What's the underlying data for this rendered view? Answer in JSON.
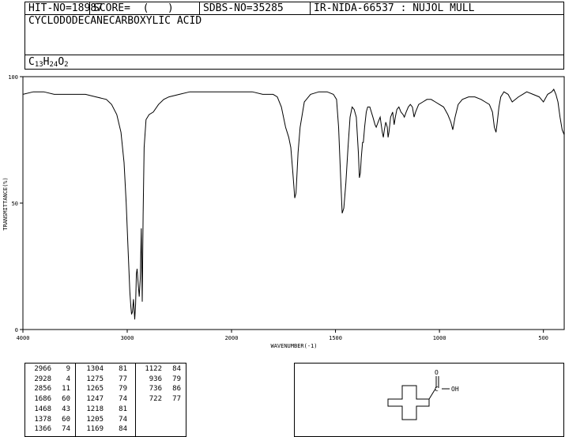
{
  "header": {
    "hit_no": "HIT-NO=18987",
    "score": "SCORE=  (   )",
    "sdbs_no": "SDBS-NO=35285",
    "ir_nida": "IR-NIDA-66537 : NUJOL MULL"
  },
  "compound": {
    "name": "CYCLODODECANECARBOXYLIC ACID",
    "formula": {
      "c": "C",
      "c_n": "13",
      "h": "H",
      "h_n": "24",
      "o": "O",
      "o_n": "2"
    }
  },
  "chart_data": {
    "type": "line",
    "xlabel": "WAVENUMBER(-1)",
    "ylabel": "TRANSMITTANCE(%)",
    "xlim": [
      4000,
      400
    ],
    "ylim": [
      0,
      100
    ],
    "x_ticks": [
      "4000",
      "3000",
      "2000",
      "1500",
      "1000",
      "500"
    ],
    "y_ticks": [
      "100",
      "50",
      "0"
    ],
    "series": [
      {
        "x": [
          4000,
          3900,
          3800,
          3700,
          3600,
          3500,
          3400,
          3300,
          3200,
          3150,
          3100,
          3060,
          3030,
          3010,
          2990,
          2975,
          2965,
          2958,
          2950,
          2940,
          2928,
          2920,
          2912,
          2905,
          2895,
          2885,
          2875,
          2865,
          2856,
          2848,
          2838,
          2820,
          2790,
          2750,
          2700,
          2650,
          2600,
          2500,
          2400,
          2300,
          2200,
          2100,
          2000,
          1900,
          1850,
          1800,
          1780,
          1760,
          1740,
          1725,
          1715,
          1705,
          1696,
          1690,
          1686,
          1680,
          1670,
          1650,
          1620,
          1580,
          1540,
          1510,
          1495,
          1485,
          1475,
          1468,
          1460,
          1450,
          1440,
          1430,
          1420,
          1410,
          1400,
          1390,
          1385,
          1380,
          1376,
          1370,
          1366,
          1360,
          1352,
          1345,
          1335,
          1320,
          1310,
          1304,
          1295,
          1285,
          1275,
          1270,
          1265,
          1258,
          1251,
          1247,
          1243,
          1235,
          1225,
          1218,
          1212,
          1205,
          1195,
          1185,
          1175,
          1169,
          1160,
          1150,
          1140,
          1130,
          1122,
          1115,
          1100,
          1080,
          1060,
          1040,
          1020,
          1000,
          980,
          960,
          945,
          936,
          925,
          910,
          890,
          860,
          830,
          800,
          780,
          760,
          745,
          736,
          728,
          722,
          714,
          705,
          690,
          670,
          650,
          620,
          600,
          580,
          550,
          520,
          500,
          480,
          460,
          450,
          440,
          430,
          420,
          410,
          400
        ],
        "y": [
          93,
          94,
          94,
          93,
          93,
          93,
          93,
          92,
          91,
          89,
          85,
          78,
          66,
          50,
          30,
          15,
          9,
          6,
          7,
          12,
          4,
          10,
          22,
          24,
          18,
          13,
          20,
          40,
          11,
          45,
          72,
          83,
          85,
          86,
          89,
          91,
          92,
          93,
          94,
          94,
          94,
          94,
          94,
          94,
          93,
          93,
          92,
          88,
          80,
          76,
          72,
          62,
          52,
          54,
          60,
          70,
          80,
          90,
          93,
          94,
          94,
          93,
          91,
          80,
          60,
          46,
          48,
          58,
          72,
          84,
          88,
          87,
          84,
          70,
          60,
          62,
          68,
          74,
          74,
          80,
          86,
          88,
          88,
          84,
          81,
          80,
          82,
          84,
          78,
          76,
          79,
          82,
          80,
          76,
          78,
          84,
          86,
          81,
          84,
          87,
          88,
          86,
          85,
          84,
          86,
          88,
          89,
          88,
          84,
          86,
          89,
          90,
          91,
          91,
          90,
          89,
          88,
          85,
          82,
          79,
          84,
          89,
          91,
          92,
          92,
          91,
          90,
          89,
          86,
          80,
          78,
          82,
          88,
          92,
          94,
          93,
          90,
          92,
          93,
          94,
          93,
          92,
          90,
          93,
          94,
          95,
          93,
          90,
          84,
          79,
          77
        ]
      }
    ],
    "peak_table": {
      "columns": [
        [
          [
            "2966",
            "9"
          ],
          [
            "2928",
            "4"
          ],
          [
            "2856",
            "11"
          ],
          [
            "1686",
            "60"
          ],
          [
            "1468",
            "43"
          ],
          [
            "1378",
            "60"
          ],
          [
            "1366",
            "74"
          ]
        ],
        [
          [
            "1304",
            "81"
          ],
          [
            "1275",
            "77"
          ],
          [
            "1265",
            "79"
          ],
          [
            "1247",
            "74"
          ],
          [
            "1218",
            "81"
          ],
          [
            "1205",
            "74"
          ],
          [
            "1169",
            "84"
          ]
        ],
        [
          [
            "1122",
            "84"
          ],
          [
            "936",
            "79"
          ],
          [
            "736",
            "86"
          ],
          [
            "722",
            "77"
          ]
        ]
      ]
    }
  },
  "structure": {
    "o_label": "O",
    "oh_label": "OH",
    "c_label": "C"
  }
}
